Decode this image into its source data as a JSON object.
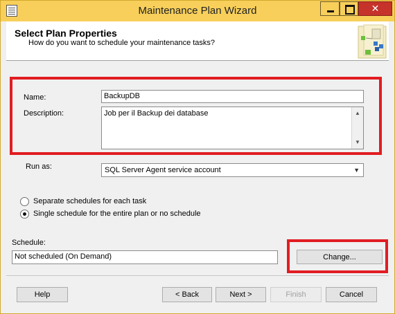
{
  "window": {
    "title": "Maintenance Plan Wizard",
    "icon": "wizard-app-icon",
    "controls": [
      "minimize-icon",
      "maximize-icon",
      "close-icon"
    ]
  },
  "header": {
    "title": "Select Plan Properties",
    "subtitle": "How do you want to schedule your maintenance tasks?",
    "illustration": "wizard-header-icon"
  },
  "form": {
    "name_label": "Name:",
    "name_value": "BackupDB",
    "description_label": "Description:",
    "description_value": "Job per il Backup dei database",
    "run_as_label": "Run as:",
    "run_as_value": "SQL Server Agent service account",
    "schedule_options": [
      {
        "label": "Separate schedules for each task",
        "checked": false
      },
      {
        "label": "Single schedule for the entire plan or no schedule",
        "checked": true
      }
    ],
    "schedule_label": "Schedule:",
    "schedule_value": "Not scheduled (On Demand)",
    "change_button": "Change..."
  },
  "footer": {
    "help": "Help",
    "back": "< Back",
    "next": "Next >",
    "finish": "Finish",
    "cancel": "Cancel"
  },
  "colors": {
    "titlebar": "#f7cf5a",
    "close_button": "#c5332b",
    "highlight": "#e11d22"
  }
}
